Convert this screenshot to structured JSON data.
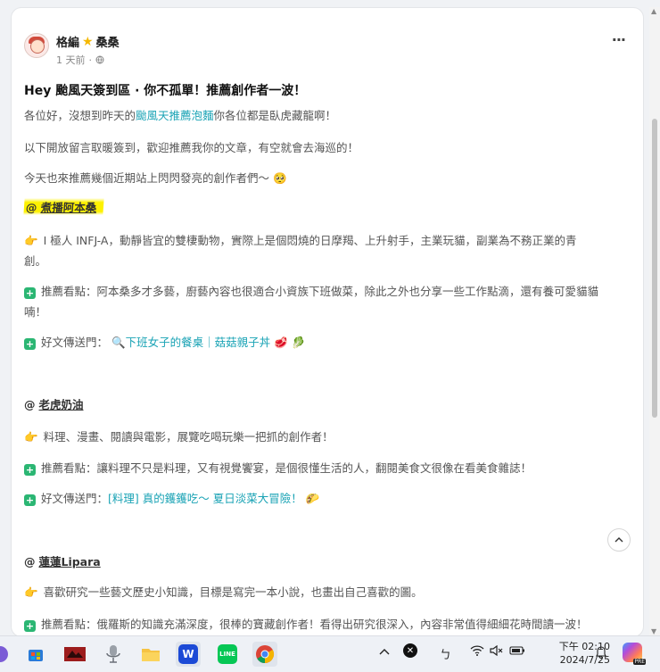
{
  "post": {
    "author": "格編",
    "author_suffix": "桑桑",
    "time": "1 天前",
    "more": "···",
    "title": "Hey 颱風天簽到區 · 你不孤單！推薦創作者一波！",
    "intro1_pre": "各位好，沒想到昨天的",
    "intro1_link": "颱風天推薦泡麵",
    "intro1_post": "你各位都是臥虎藏龍啊！",
    "intro2": "以下開放留言取暖簽到，歡迎推薦我你的文章，有空就會去海巡的！",
    "intro3": "今天也來推薦幾個近期站上閃閃發亮的創作者們～",
    "intro3_emoji": "🥺"
  },
  "creators": [
    {
      "at": "@",
      "name": "煮播阿本桑",
      "desc_l1": "I 極人 INFJ-A，動靜皆宜的雙棲動物，實際上是個悶燒的日摩羯、上升射手，主業玩貓，副業為不務正業的青",
      "desc_l2": "創。",
      "rec_label": "推薦看點：",
      "rec_l1": "阿本桑多才多藝，廚藝內容也很適合小資族下班做菜，除此之外也分享一些工作點滴，還有養可愛貓貓",
      "rec_l2": "喃！",
      "link_label": "好文傳送門：",
      "link_text": "下班女子的餐桌｜菇菇親子丼",
      "link_emojis": "🥩 🥬"
    },
    {
      "at": "@",
      "name": "老虎奶油",
      "desc_l1": "料理、漫畫、閱讀與電影，展覽吃喝玩樂一把抓的創作者！",
      "rec_label": "推薦看點：",
      "rec_l1": "讓料理不只是料理，又有視覺饗宴，是個很懂生活的人，翻閱美食文很像在看美食雜誌！",
      "link_label": "好文傳送門：",
      "link_text": "[料理] 真的鑊鑊吃～ 夏日淡菜大冒險！",
      "link_emojis": "🌮"
    },
    {
      "at": "@",
      "name": "蓮蓮Lipara",
      "desc_l1": "喜歡研究一些藝文歷史小知識，目標是寫完一本小說，也畫出自己喜歡的圖。",
      "rec_label": "推薦看點：",
      "rec_l1": "俄羅斯的知識充滿深度，很棒的寶藏創作者！看得出研究很深入，內容非常值得細細花時間讀一波！"
    }
  ],
  "taskbar": {
    "time": "下午 02:10",
    "date": "2024/7/25",
    "copilot_badge": "PRE"
  },
  "colors": {
    "link": "#1aa3b5",
    "highlight": "#fdf100",
    "check_icon": "#2bb673"
  }
}
